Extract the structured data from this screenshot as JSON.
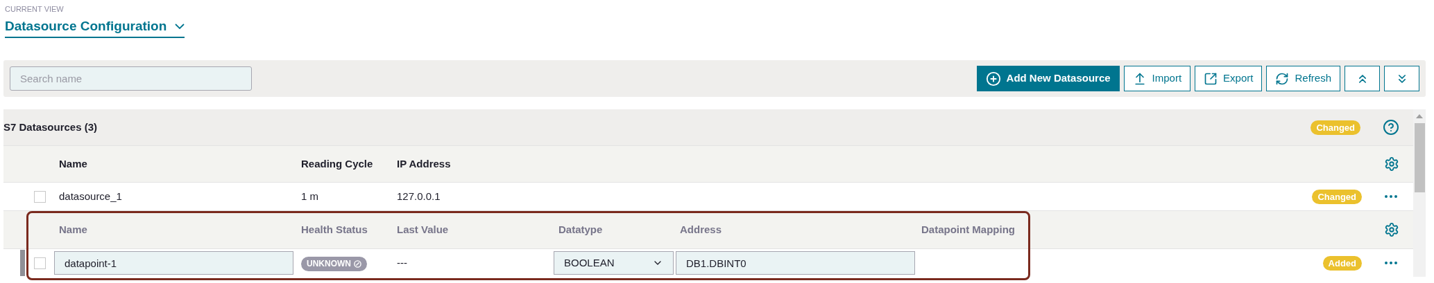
{
  "current_view": {
    "label": "CURRENT VIEW",
    "title": "Datasource Configuration"
  },
  "toolbar": {
    "search": {
      "placeholder": "Search name"
    },
    "buttons": [
      {
        "kind": "add",
        "label": "Add New Datasource"
      },
      {
        "kind": "import",
        "label": "Import"
      },
      {
        "kind": "export",
        "label": "Export"
      },
      {
        "kind": "refresh",
        "label": "Refresh"
      },
      {
        "kind": "collapse"
      },
      {
        "kind": "expand"
      }
    ]
  },
  "group": {
    "title": "S7 Datasources (3)",
    "status": "Changed"
  },
  "datasource_columns": [
    "Name",
    "Reading Cycle",
    "IP Address"
  ],
  "datasources": [
    {
      "name": "datasource_1",
      "reading_cycle": "1 m",
      "ip_address": "127.0.0.1",
      "status": "Changed",
      "checked": false
    }
  ],
  "datapoint_columns": [
    "Name",
    "Health Status",
    "Last Value",
    "Datatype",
    "Address",
    "Datapoint Mapping"
  ],
  "datapoints": [
    {
      "name": "datapoint-1",
      "health_status": "UNKNOWN",
      "last_value": "---",
      "datatype": "BOOLEAN",
      "address": "DB1.DBINT0",
      "status": "Added",
      "checked": false
    }
  ]
}
